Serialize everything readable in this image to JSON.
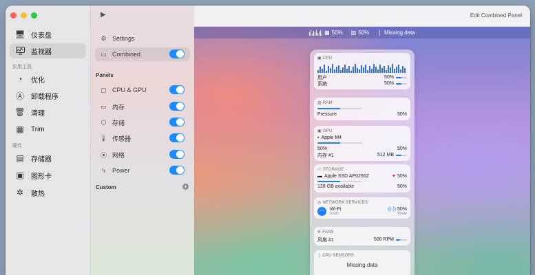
{
  "sidebar": {
    "items_top": [
      {
        "label": "仪表盘",
        "icon": "display-icon"
      },
      {
        "label": "监视器",
        "icon": "monitor-icon",
        "active": true
      }
    ],
    "section1": "实用工具",
    "items_utils": [
      {
        "label": "优化",
        "icon": "gauge-icon"
      },
      {
        "label": "卸载程序",
        "icon": "appstore-icon"
      },
      {
        "label": "清理",
        "icon": "trash-icon"
      },
      {
        "label": "Trim",
        "icon": "grid-icon"
      }
    ],
    "section2": "硬件",
    "items_hw": [
      {
        "label": "存储器",
        "icon": "chip-icon"
      },
      {
        "label": "图形卡",
        "icon": "gpu-icon"
      },
      {
        "label": "散热",
        "icon": "fan-icon"
      }
    ]
  },
  "middle": {
    "settings_label": "Settings",
    "combined_label": "Combined",
    "panels_header": "Panels",
    "panels": [
      {
        "label": "CPU & GPU",
        "icon": "cpu-icon"
      },
      {
        "label": "内存",
        "icon": "memory-icon"
      },
      {
        "label": "存储",
        "icon": "storage-icon"
      },
      {
        "label": "传感器",
        "icon": "thermometer-icon"
      },
      {
        "label": "网络",
        "icon": "antenna-icon"
      },
      {
        "label": "Power",
        "icon": "bolt-icon"
      }
    ],
    "custom_header": "Custom"
  },
  "titlebar": {
    "title": "Edit Combined Panel"
  },
  "menubar": {
    "cpu_pct": "50%",
    "ram_pct": "50%",
    "sensor_text": "Missing data"
  },
  "panel": {
    "cpu": {
      "header": "CPU",
      "user_label": "用户",
      "user_val": "50%",
      "user_pct": 50,
      "sys_label": "系统",
      "sys_val": "50%",
      "sys_pct": 50
    },
    "ram": {
      "header": "RAM",
      "pressure_label": "Pressure",
      "pressure_val": "50%",
      "pressure_pct": 50
    },
    "gpu": {
      "header": "GPU",
      "name": "Apple M4",
      "load_val": "50%",
      "load_pct": 50,
      "mem_val": "50%",
      "mem_label": "内存 #1",
      "mem_size": "512 MB"
    },
    "storage": {
      "header": "STORAGE",
      "name": "Apple SSD AP0256Z",
      "health": "50%",
      "avail": "128 GB available",
      "avail_pct": "50%"
    },
    "network": {
      "header": "NETWORK SERVICES",
      "name": "Wi-Fi",
      "sub": "SSID",
      "signal": "50%",
      "mode": "Mode"
    },
    "fans": {
      "header": "FANS",
      "label": "风扇 #1",
      "val": "500 RPM"
    },
    "sensors": {
      "header": "CPU SENSORS",
      "val": "Missing data"
    }
  }
}
